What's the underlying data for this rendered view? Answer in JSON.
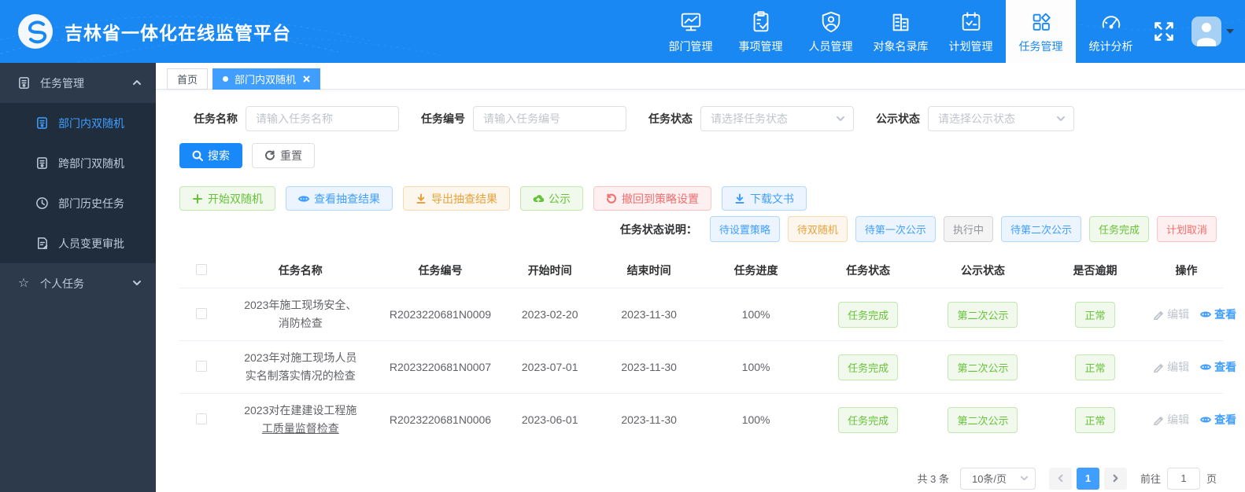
{
  "colors": {
    "header_bg": "#1a88f2",
    "sidebar_bg": "#2d3a4b",
    "submenu_bg": "#1f2d3d",
    "accent_blue": "#409eff",
    "success_green": "#67c23a",
    "warning_orange": "#e6a23c",
    "danger_red": "#f56c6c",
    "info_gray": "#909399"
  },
  "header": {
    "title": "吉林省一体化在线监管平台",
    "nav": [
      {
        "label": "部门管理",
        "icon": "monitor-chart-icon"
      },
      {
        "label": "事项管理",
        "icon": "clipboard-check-icon"
      },
      {
        "label": "人员管理",
        "icon": "shield-user-icon"
      },
      {
        "label": "对象名录库",
        "icon": "buildings-icon"
      },
      {
        "label": "计划管理",
        "icon": "calendar-check-icon"
      },
      {
        "label": "任务管理",
        "icon": "grid-diamond-icon",
        "active": true
      },
      {
        "label": "统计分析",
        "icon": "gauge-icon"
      }
    ]
  },
  "sidebar": {
    "group_task": {
      "label": "任务管理",
      "expanded": true
    },
    "items": [
      {
        "label": "部门内双随机",
        "active": true
      },
      {
        "label": "跨部门双随机"
      },
      {
        "label": "部门历史任务"
      },
      {
        "label": "人员变更审批"
      }
    ],
    "group_personal": {
      "label": "个人任务",
      "expanded": false
    }
  },
  "tabs": [
    {
      "label": "首页"
    },
    {
      "label": "部门内双随机",
      "active": true,
      "closable": true
    }
  ],
  "filters": {
    "task_name": {
      "label": "任务名称",
      "placeholder": "请输入任务名称",
      "value": ""
    },
    "task_code": {
      "label": "任务编号",
      "placeholder": "请输入任务编号",
      "value": ""
    },
    "task_status": {
      "label": "任务状态",
      "placeholder": "请选择任务状态"
    },
    "public_status": {
      "label": "公示状态",
      "placeholder": "请选择公示状态"
    }
  },
  "toolbar": {
    "search_label": "搜索",
    "reset_label": "重置"
  },
  "actions": [
    {
      "label": "开始双随机",
      "type": "success",
      "icon": "plus-icon"
    },
    {
      "label": "查看抽查结果",
      "type": "primary",
      "icon": "eye-icon"
    },
    {
      "label": "导出抽查结果",
      "type": "warning",
      "icon": "download-icon"
    },
    {
      "label": "公示",
      "type": "success",
      "icon": "cloud-upload-icon"
    },
    {
      "label": "撤回到策略设置",
      "type": "danger",
      "icon": "undo-icon"
    },
    {
      "label": "下载文书",
      "type": "primary",
      "icon": "download-icon"
    }
  ],
  "legend": {
    "label": "任务状态说明：",
    "badges": [
      {
        "label": "待设置策略",
        "type": "primary"
      },
      {
        "label": "待双随机",
        "type": "warning"
      },
      {
        "label": "待第一次公示",
        "type": "primary"
      },
      {
        "label": "执行中",
        "type": "info"
      },
      {
        "label": "待第二次公示",
        "type": "primary"
      },
      {
        "label": "任务完成",
        "type": "success"
      },
      {
        "label": "计划取消",
        "type": "danger"
      }
    ]
  },
  "table": {
    "columns": {
      "name": "任务名称",
      "code": "任务编号",
      "start": "开始时间",
      "end": "结束时间",
      "progress": "任务进度",
      "status": "任务状态",
      "public": "公示状态",
      "overdue": "是否逾期",
      "ops": "操作"
    },
    "rows": [
      {
        "name_line1": "2023年施工现场安全、",
        "name_line2": "消防检查",
        "code": "R2023220681N0009",
        "start": "2023-02-20",
        "end": "2023-11-30",
        "progress": "100%",
        "status": "任务完成",
        "public": "第二次公示",
        "overdue": "正常",
        "edit": "编辑",
        "view": "查看"
      },
      {
        "name_line1": "2023年对施工现场人员",
        "name_line2": "实名制落实情况的检查",
        "code": "R2023220681N0007",
        "start": "2023-07-01",
        "end": "2023-11-30",
        "progress": "100%",
        "status": "任务完成",
        "public": "第二次公示",
        "overdue": "正常",
        "edit": "编辑",
        "view": "查看"
      },
      {
        "name_line1": "2023对在建建设工程施",
        "name_line2": "工质量监督检查",
        "code": "R2023220681N0006",
        "start": "2023-06-01",
        "end": "2023-11-30",
        "progress": "100%",
        "status": "任务完成",
        "public": "第二次公示",
        "overdue": "正常",
        "edit": "编辑",
        "view": "查看"
      }
    ]
  },
  "pagination": {
    "total_text": "共 3 条",
    "page_size": "10条/页",
    "current_page": "1",
    "goto_label": "前往",
    "goto_value": "1",
    "page_word": "页"
  }
}
